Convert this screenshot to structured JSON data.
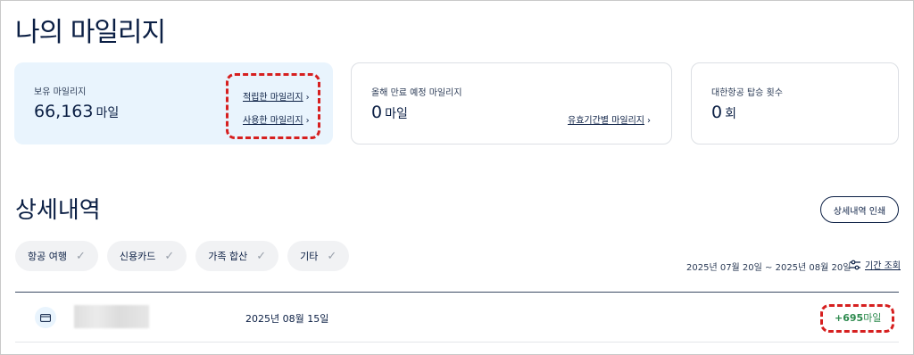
{
  "page": {
    "title": "나의 마일리지"
  },
  "summary": {
    "held": {
      "label": "보유 마일리지",
      "value": "66,163",
      "unit": "마일",
      "links": [
        {
          "label": "적립한 마일리지"
        },
        {
          "label": "사용한 마일리지"
        }
      ]
    },
    "expiring": {
      "label": "올해 만료 예정 마일리지",
      "value": "0",
      "unit": "마일",
      "link": "유효기간별 마일리지"
    },
    "boarding": {
      "label": "대한항공 탑승 횟수",
      "value": "0",
      "unit": "회"
    }
  },
  "details": {
    "title": "상세내역",
    "print_label": "상세내역 인쇄",
    "filters": [
      {
        "label": "항공 여행"
      },
      {
        "label": "신용카드"
      },
      {
        "label": "가족 합산"
      },
      {
        "label": "기타"
      }
    ],
    "date_range": "2025년 07월 20일 ~ 2025년 08월 20일",
    "period_search_label": "기간 조회",
    "rows": [
      {
        "date": "2025년 08월 15일",
        "amount": "+695",
        "unit": "마일"
      }
    ]
  },
  "colors": {
    "accent": "#0b1f44",
    "highlight": "#d61f1f",
    "positive": "#2d8a4e",
    "card_bg": "#e9f4fd"
  }
}
